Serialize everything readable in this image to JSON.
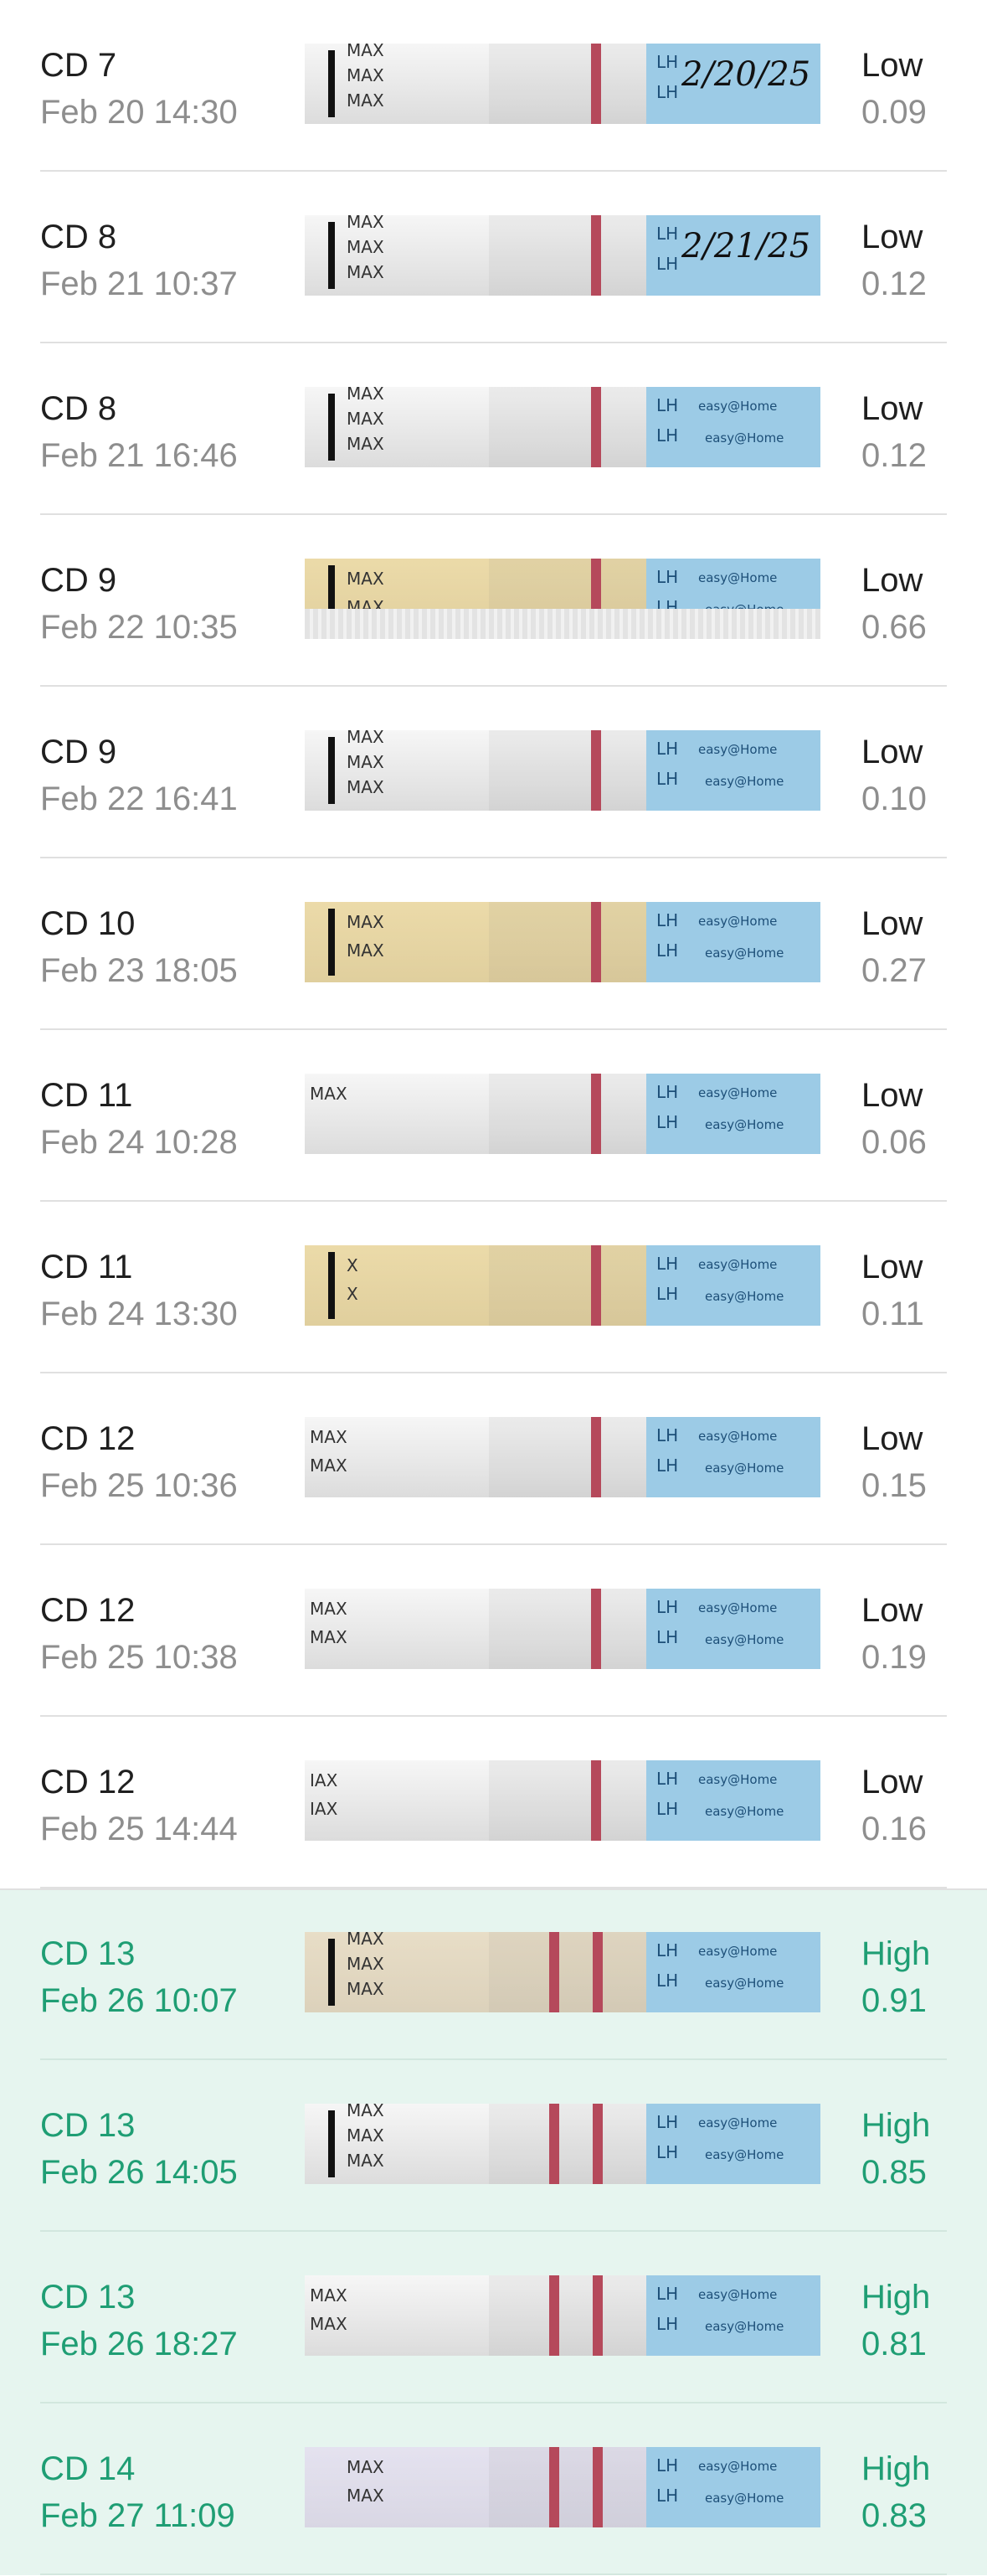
{
  "rows": [
    {
      "cd": "CD 7",
      "datetime": "Feb 20 14:30",
      "level": "Low",
      "value": "0.09",
      "high": false,
      "strip": {
        "tint": "none",
        "lines": 1,
        "note": "2/20/25",
        "max_labels": [
          "MAX",
          "MAX",
          "MAX"
        ]
      }
    },
    {
      "cd": "CD 8",
      "datetime": "Feb 21 10:37",
      "level": "Low",
      "value": "0.12",
      "high": false,
      "strip": {
        "tint": "none",
        "lines": 1,
        "note": "2/21/25",
        "max_labels": [
          "MAX",
          "MAX",
          "MAX"
        ]
      }
    },
    {
      "cd": "CD 8",
      "datetime": "Feb 21 16:46",
      "level": "Low",
      "value": "0.12",
      "high": false,
      "strip": {
        "tint": "none",
        "lines": 1,
        "note": "",
        "max_labels": [
          "MAX",
          "MAX",
          "MAX"
        ]
      }
    },
    {
      "cd": "CD 9",
      "datetime": "Feb 22 10:35",
      "level": "Low",
      "value": "0.66",
      "high": false,
      "strip": {
        "tint": "yellow",
        "lines": 1,
        "note": "",
        "max_labels": [
          "MAX",
          "MAX"
        ]
      }
    },
    {
      "cd": "CD 9",
      "datetime": "Feb 22 16:41",
      "level": "Low",
      "value": "0.10",
      "high": false,
      "strip": {
        "tint": "none",
        "lines": 1,
        "note": "",
        "max_labels": [
          "MAX",
          "MAX",
          "MAX"
        ]
      }
    },
    {
      "cd": "CD 10",
      "datetime": "Feb 23 18:05",
      "level": "Low",
      "value": "0.27",
      "high": false,
      "strip": {
        "tint": "yellow",
        "lines": 1,
        "note": "",
        "max_labels": [
          "MAX",
          "MAX"
        ]
      }
    },
    {
      "cd": "CD 11",
      "datetime": "Feb 24 10:28",
      "level": "Low",
      "value": "0.06",
      "high": false,
      "strip": {
        "tint": "none",
        "lines": 1,
        "note": "",
        "max_labels": [
          "MAX"
        ]
      }
    },
    {
      "cd": "CD 11",
      "datetime": "Feb 24 13:30",
      "level": "Low",
      "value": "0.11",
      "high": false,
      "strip": {
        "tint": "yellow",
        "lines": 1,
        "note": "",
        "max_labels": [
          "X",
          "X"
        ]
      }
    },
    {
      "cd": "CD 12",
      "datetime": "Feb 25 10:36",
      "level": "Low",
      "value": "0.15",
      "high": false,
      "strip": {
        "tint": "none",
        "lines": 1,
        "note": "",
        "max_labels": [
          "MAX",
          "MAX"
        ]
      }
    },
    {
      "cd": "CD 12",
      "datetime": "Feb 25 10:38",
      "level": "Low",
      "value": "0.19",
      "high": false,
      "strip": {
        "tint": "none",
        "lines": 1,
        "note": "",
        "max_labels": [
          "MAX",
          "MAX"
        ]
      }
    },
    {
      "cd": "CD 12",
      "datetime": "Feb 25 14:44",
      "level": "Low",
      "value": "0.16",
      "high": false,
      "strip": {
        "tint": "none",
        "lines": 1,
        "note": "",
        "max_labels": [
          "IAX",
          "IAX"
        ]
      }
    },
    {
      "cd": "CD 13",
      "datetime": "Feb 26 10:07",
      "level": "High",
      "value": "0.91",
      "high": true,
      "strip": {
        "tint": "beige",
        "lines": 2,
        "note": "",
        "max_labels": [
          "MAX",
          "MAX",
          "MAX"
        ]
      }
    },
    {
      "cd": "CD 13",
      "datetime": "Feb 26 14:05",
      "level": "High",
      "value": "0.85",
      "high": true,
      "strip": {
        "tint": "none",
        "lines": 2,
        "note": "",
        "max_labels": [
          "MAX",
          "MAX",
          "MAX"
        ]
      }
    },
    {
      "cd": "CD 13",
      "datetime": "Feb 26 18:27",
      "level": "High",
      "value": "0.81",
      "high": true,
      "strip": {
        "tint": "none",
        "lines": 2,
        "note": "",
        "max_labels": [
          "MAX",
          "MAX"
        ]
      }
    },
    {
      "cd": "CD 14",
      "datetime": "Feb 27 11:09",
      "level": "High",
      "value": "0.83",
      "high": true,
      "strip": {
        "tint": "lavender",
        "lines": 2,
        "note": "",
        "max_labels": [
          "MAX",
          "MAX"
        ]
      }
    }
  ],
  "strip_brand": {
    "lh": "LH",
    "brand": "easy@Home"
  },
  "colors": {
    "high_text": "#1f9e74",
    "high_bg": "#e6f5ef",
    "low_text": "#1f1f1f",
    "secondary_text": "#8e8e8e",
    "test_line": "#b5495b",
    "handle": "#9ccbe6"
  }
}
